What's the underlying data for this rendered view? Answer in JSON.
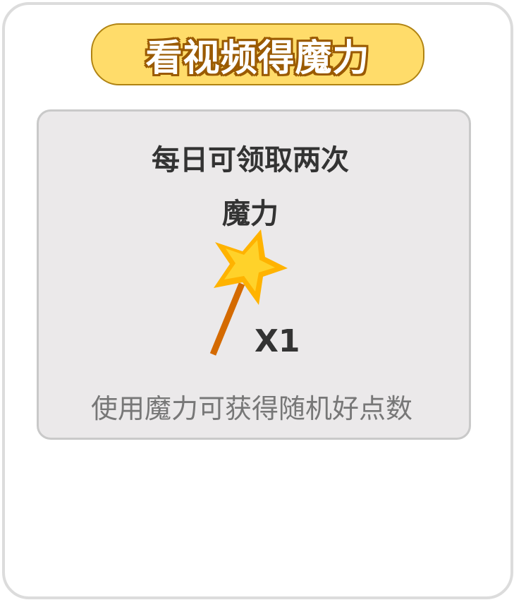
{
  "header": {
    "title": "看视频得魔力"
  },
  "card": {
    "line1": "每日可领取两次",
    "line2": "魔力",
    "item_icon": "magic-wand-star-icon",
    "quantity": "X1",
    "description": "使用魔力可获得随机好点数"
  },
  "colors": {
    "banner": "#ffdc6a",
    "banner_outline": "#9a5a00",
    "star": "#ffc107",
    "wand": "#d46a00"
  }
}
